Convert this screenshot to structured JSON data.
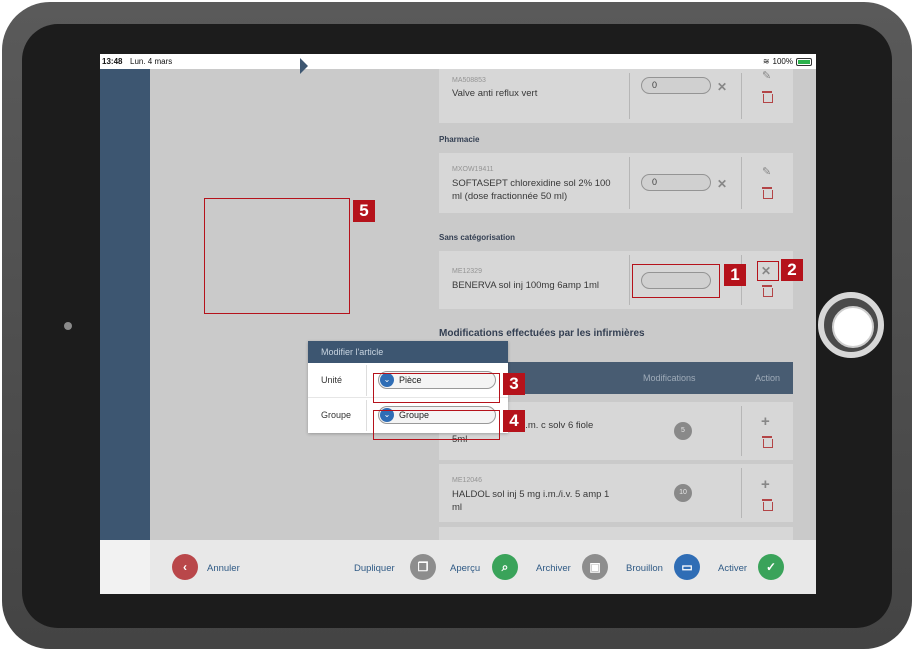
{
  "status_bar": {
    "time": "13:48",
    "date": "Lun. 4 mars",
    "battery": "100%"
  },
  "items": [
    {
      "code": "MA508853",
      "name": "Valve anti reflux vert",
      "qty": "0"
    }
  ],
  "sections": {
    "pharmacie": "Pharmacie",
    "sans_categorisation": "Sans catégorisation",
    "modifications": "Modifications effectuées par les infirmières"
  },
  "pharmacie_item": {
    "code": "MXOW19411",
    "name_line1": "SOFTASEPT chlorexidine sol 2% 100",
    "name_line2": "ml (dose fractionnée 50 ml)",
    "qty": "0"
  },
  "sans_cat_item": {
    "code": "ME12329",
    "name": "BENERVA sol inj 100mg 6amp 1ml",
    "qty": ""
  },
  "table": {
    "headers": {
      "modifications": "Modifications",
      "action": "Action"
    },
    "rows": [
      {
        "code": "",
        "name_line1": "i.v./i.m. c solv 6 fiole",
        "name_line2": "5ml",
        "modifications": "5"
      },
      {
        "code": "ME12046",
        "name_line1": "HALDOL sol inj 5 mg i.m./i.v. 5 amp 1",
        "name_line2": "ml",
        "modifications": "10"
      }
    ]
  },
  "popover": {
    "title": "Modifier l'article",
    "unit_label": "Unité",
    "unit_value": "Pièce",
    "group_label": "Groupe",
    "group_value": "Groupe"
  },
  "annotations": [
    "1",
    "2",
    "3",
    "4",
    "5"
  ],
  "bottom_bar": {
    "cancel": "Annuler",
    "duplicate": "Dupliquer",
    "preview": "Aperçu",
    "archive": "Archiver",
    "draft": "Brouillon",
    "activate": "Activer"
  },
  "colors": {
    "nav": "#3d5671",
    "cancel": "#b9474a",
    "preview": "#3aa35a",
    "archive": "#8d8d8d",
    "draft": "#2f6db5",
    "activate": "#3aa35a",
    "annotation": "#b5121b"
  }
}
